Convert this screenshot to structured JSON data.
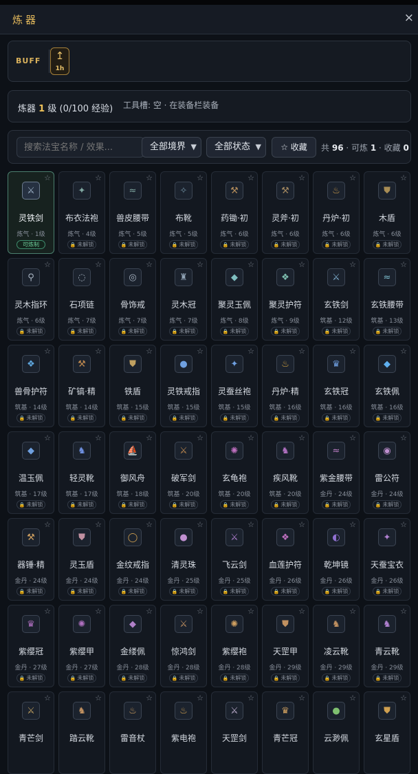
{
  "header": {
    "title": "炼器",
    "close_label": "×"
  },
  "buff": {
    "label": "BUFF",
    "badge_icon": "↥",
    "badge_duration": "1h"
  },
  "status": {
    "level_prefix": "炼器",
    "level_value": "1",
    "level_suffix": "级",
    "exp": "(0/100 经验)",
    "tool_slot": "工具槽: 空 · 在装备栏装备"
  },
  "filters": {
    "search_placeholder": "搜索法宝名称 / 效果...",
    "realm_select": "全部境界",
    "state_select": "全部状态",
    "favorites_button": "☆ 收藏",
    "count_total_prefix": "共",
    "count_total": "96",
    "count_craftable_prefix": "· 可炼",
    "count_craftable": "1",
    "count_fav_prefix": "· 收藏",
    "count_fav": "0"
  },
  "items": [
    {
      "name": "灵铁剑",
      "req": "炼气 · 1级",
      "tag": "可炼制",
      "craftable": true,
      "icon": "⚔",
      "color": "#9fb4c8"
    },
    {
      "name": "布衣法袍",
      "req": "炼气 · 4级",
      "tag": "未解锁",
      "icon": "✦",
      "color": "#7fa7a0"
    },
    {
      "name": "兽皮腰带",
      "req": "炼气 · 5级",
      "tag": "未解锁",
      "icon": "≈",
      "color": "#7fa7a0"
    },
    {
      "name": "布靴",
      "req": "炼气 · 5级",
      "tag": "未解锁",
      "icon": "✧",
      "color": "#6f8fa0"
    },
    {
      "name": "药锄·初",
      "req": "炼气 · 6级",
      "tag": "未解锁",
      "icon": "⚒",
      "color": "#b08a5a"
    },
    {
      "name": "灵斧·初",
      "req": "炼气 · 6级",
      "tag": "未解锁",
      "icon": "⚒",
      "color": "#a0865f"
    },
    {
      "name": "丹炉·初",
      "req": "炼气 · 6级",
      "tag": "未解锁",
      "icon": "♨",
      "color": "#c99a4a"
    },
    {
      "name": "木盾",
      "req": "炼气 · 6级",
      "tag": "未解锁",
      "icon": "⛊",
      "color": "#a88d55"
    },
    {
      "name": "灵木指环",
      "req": "炼气 · 6级",
      "tag": "未解锁",
      "icon": "⚲",
      "color": "#a8b4c2"
    },
    {
      "name": "石项链",
      "req": "炼气 · 7级",
      "tag": "未解锁",
      "icon": "◌",
      "color": "#a8b4c2"
    },
    {
      "name": "骨饰戒",
      "req": "炼气 · 7级",
      "tag": "未解锁",
      "icon": "◎",
      "color": "#a8b4c2"
    },
    {
      "name": "灵木冠",
      "req": "炼气 · 7级",
      "tag": "未解锁",
      "icon": "♜",
      "color": "#8fa2b4"
    },
    {
      "name": "聚灵玉佩",
      "req": "炼气 · 8级",
      "tag": "未解锁",
      "icon": "◆",
      "color": "#7fbfc0"
    },
    {
      "name": "聚灵护符",
      "req": "炼气 · 9级",
      "tag": "未解锁",
      "icon": "❖",
      "color": "#7fbfb0"
    },
    {
      "name": "玄铁剑",
      "req": "筑基 · 12级",
      "tag": "未解锁",
      "icon": "⚔",
      "color": "#7fb0d0"
    },
    {
      "name": "玄铁腰带",
      "req": "筑基 · 13级",
      "tag": "未解锁",
      "icon": "≈",
      "color": "#7fc0d0"
    },
    {
      "name": "兽骨护符",
      "req": "筑基 · 14级",
      "tag": "未解锁",
      "icon": "❖",
      "color": "#5fa8e0"
    },
    {
      "name": "矿镐·精",
      "req": "筑基 · 14级",
      "tag": "未解锁",
      "icon": "⚒",
      "color": "#c08a50"
    },
    {
      "name": "铁盾",
      "req": "筑基 · 15级",
      "tag": "未解锁",
      "icon": "⛊",
      "color": "#c0a060"
    },
    {
      "name": "灵铁戒指",
      "req": "筑基 · 15级",
      "tag": "未解锁",
      "icon": "●",
      "color": "#6fa0e0"
    },
    {
      "name": "灵蚕丝袍",
      "req": "筑基 · 15级",
      "tag": "未解锁",
      "icon": "✦",
      "color": "#6fa0e0"
    },
    {
      "name": "丹炉·精",
      "req": "筑基 · 16级",
      "tag": "未解锁",
      "icon": "♨",
      "color": "#d0a040"
    },
    {
      "name": "玄铁冠",
      "req": "筑基 · 16级",
      "tag": "未解锁",
      "icon": "♛",
      "color": "#6f9fe0"
    },
    {
      "name": "玄铁佩",
      "req": "筑基 · 16级",
      "tag": "未解锁",
      "icon": "◆",
      "color": "#5fb0f0"
    },
    {
      "name": "温玉佩",
      "req": "筑基 · 17级",
      "tag": "未解锁",
      "icon": "◆",
      "color": "#6fa0e0"
    },
    {
      "name": "轻灵靴",
      "req": "筑基 · 17级",
      "tag": "未解锁",
      "icon": "♞",
      "color": "#6f90e0"
    },
    {
      "name": "御风舟",
      "req": "筑基 · 18级",
      "tag": "未解锁",
      "icon": "⛵",
      "color": "#6f90e0"
    },
    {
      "name": "破军剑",
      "req": "筑基 · 20级",
      "tag": "未解锁",
      "icon": "⚔",
      "color": "#c08a50"
    },
    {
      "name": "玄龟袍",
      "req": "筑基 · 20级",
      "tag": "未解锁",
      "icon": "✺",
      "color": "#c070c0"
    },
    {
      "name": "疾风靴",
      "req": "筑基 · 20级",
      "tag": "未解锁",
      "icon": "♞",
      "color": "#b070c0"
    },
    {
      "name": "紫金腰带",
      "req": "金丹 · 24级",
      "tag": "未解锁",
      "icon": "≈",
      "color": "#c080c8"
    },
    {
      "name": "雷公符",
      "req": "金丹 · 24级",
      "tag": "未解锁",
      "icon": "◉",
      "color": "#c090d0"
    },
    {
      "name": "器锤·精",
      "req": "金丹 · 24级",
      "tag": "未解锁",
      "icon": "⚒",
      "color": "#d0a060"
    },
    {
      "name": "灵玉盾",
      "req": "金丹 · 24级",
      "tag": "未解锁",
      "icon": "⛊",
      "color": "#c090a0"
    },
    {
      "name": "金纹戒指",
      "req": "金丹 · 24级",
      "tag": "未解锁",
      "icon": "◯",
      "color": "#d0a050"
    },
    {
      "name": "清灵珠",
      "req": "金丹 · 25级",
      "tag": "未解锁",
      "icon": "●",
      "color": "#c090d0"
    },
    {
      "name": "飞云剑",
      "req": "金丹 · 25级",
      "tag": "未解锁",
      "icon": "⚔",
      "color": "#b080d0"
    },
    {
      "name": "血莲护符",
      "req": "金丹 · 26级",
      "tag": "未解锁",
      "icon": "❖",
      "color": "#c070c0"
    },
    {
      "name": "乾坤镜",
      "req": "金丹 · 26级",
      "tag": "未解锁",
      "icon": "◐",
      "color": "#9070d0"
    },
    {
      "name": "天蚕宝衣",
      "req": "金丹 · 26级",
      "tag": "未解锁",
      "icon": "✦",
      "color": "#b080d0"
    },
    {
      "name": "紫缨冠",
      "req": "金丹 · 27级",
      "tag": "未解锁",
      "icon": "♛",
      "color": "#b070c0"
    },
    {
      "name": "紫缨甲",
      "req": "金丹 · 27级",
      "tag": "未解锁",
      "icon": "✺",
      "color": "#b070c0"
    },
    {
      "name": "金缕佩",
      "req": "金丹 · 28级",
      "tag": "未解锁",
      "icon": "◆",
      "color": "#b080c8"
    },
    {
      "name": "惊鸿剑",
      "req": "金丹 · 28级",
      "tag": "未解锁",
      "icon": "⚔",
      "color": "#c09060"
    },
    {
      "name": "紫缨袍",
      "req": "金丹 · 28级",
      "tag": "未解锁",
      "icon": "✺",
      "color": "#d0a060"
    },
    {
      "name": "天罡甲",
      "req": "金丹 · 29级",
      "tag": "未解锁",
      "icon": "⛊",
      "color": "#c09060"
    },
    {
      "name": "凌云靴",
      "req": "金丹 · 29级",
      "tag": "未解锁",
      "icon": "♞",
      "color": "#c09060"
    },
    {
      "name": "青云靴",
      "req": "金丹 · 29级",
      "tag": "未解锁",
      "icon": "♞",
      "color": "#b080d0"
    },
    {
      "name": "青芒剑",
      "req": "",
      "tag": "",
      "icon": "⚔",
      "color": "#c0a060"
    },
    {
      "name": "踏云靴",
      "req": "",
      "tag": "",
      "icon": "♞",
      "color": "#c09060"
    },
    {
      "name": "雷音杖",
      "req": "",
      "tag": "",
      "icon": "♨",
      "color": "#d0a060"
    },
    {
      "name": "紫电袍",
      "req": "",
      "tag": "",
      "icon": "♨",
      "color": "#d0a050"
    },
    {
      "name": "天罡剑",
      "req": "",
      "tag": "",
      "icon": "⚔",
      "color": "#c0b0d0"
    },
    {
      "name": "青芒冠",
      "req": "",
      "tag": "",
      "icon": "♛",
      "color": "#d0a060"
    },
    {
      "name": "云渺佩",
      "req": "",
      "tag": "",
      "icon": "●",
      "color": "#7fc070"
    },
    {
      "name": "玄星盾",
      "req": "",
      "tag": "",
      "icon": "⛊",
      "color": "#d0a050"
    }
  ]
}
